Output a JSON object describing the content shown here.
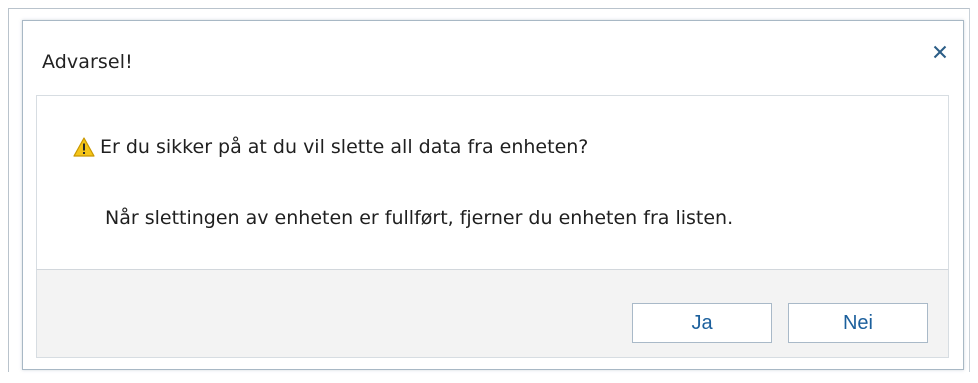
{
  "dialog": {
    "title": "Advarsel!",
    "close_symbol": "×",
    "icons": {
      "close": "close-icon",
      "warning": "warning-icon"
    },
    "question": "Er du sikker på at du vil slette all data fra enheten?",
    "info": "Når slettingen av enheten er fullført, fjerner du enheten fra listen.",
    "buttons": {
      "yes_label": "Ja",
      "no_label": "Nei"
    }
  },
  "colors": {
    "accent_text": "#1b5f9c",
    "footer_background": "#f3f3f3",
    "warning_fill": "#f5c518"
  }
}
